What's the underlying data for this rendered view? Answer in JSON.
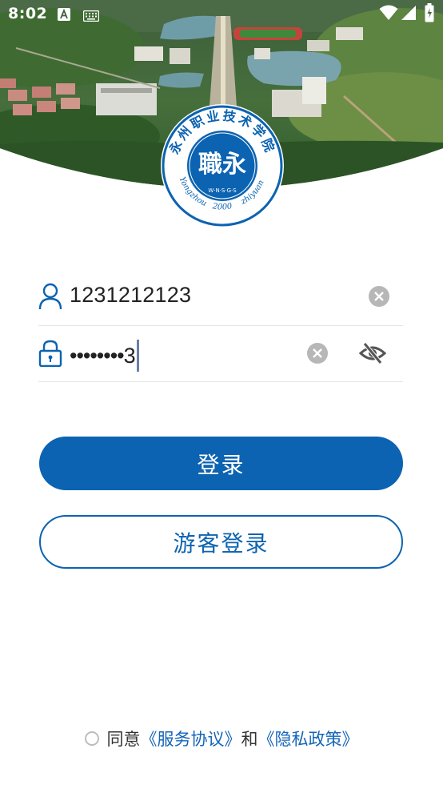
{
  "status_bar": {
    "time": "8:02",
    "icons": [
      "a-notification-icon",
      "keyboard-icon",
      "wifi-icon",
      "cellular-signal-icon",
      "battery-icon"
    ]
  },
  "logo": {
    "name_text": "永州职业技术学院",
    "calligraphy": "職永",
    "initials": "W·N·S·G·S",
    "latin_left": "Yongzhou",
    "year": "2000",
    "latin_right": "zhiyuan",
    "color": "#0c63b1"
  },
  "form": {
    "account_value": "1231212123",
    "password_mask": "••••••••",
    "password_last_char": "3"
  },
  "buttons": {
    "login_label": "登录",
    "guest_login_label": "游客登录"
  },
  "agreement": {
    "prefix": "同意",
    "service_link": "《服务协议》",
    "conjunction": "和",
    "privacy_link": "《隐私政策》"
  },
  "colors": {
    "primary": "#0c63b1",
    "link": "#1565b8",
    "clear_button": "#b7b7b7"
  }
}
